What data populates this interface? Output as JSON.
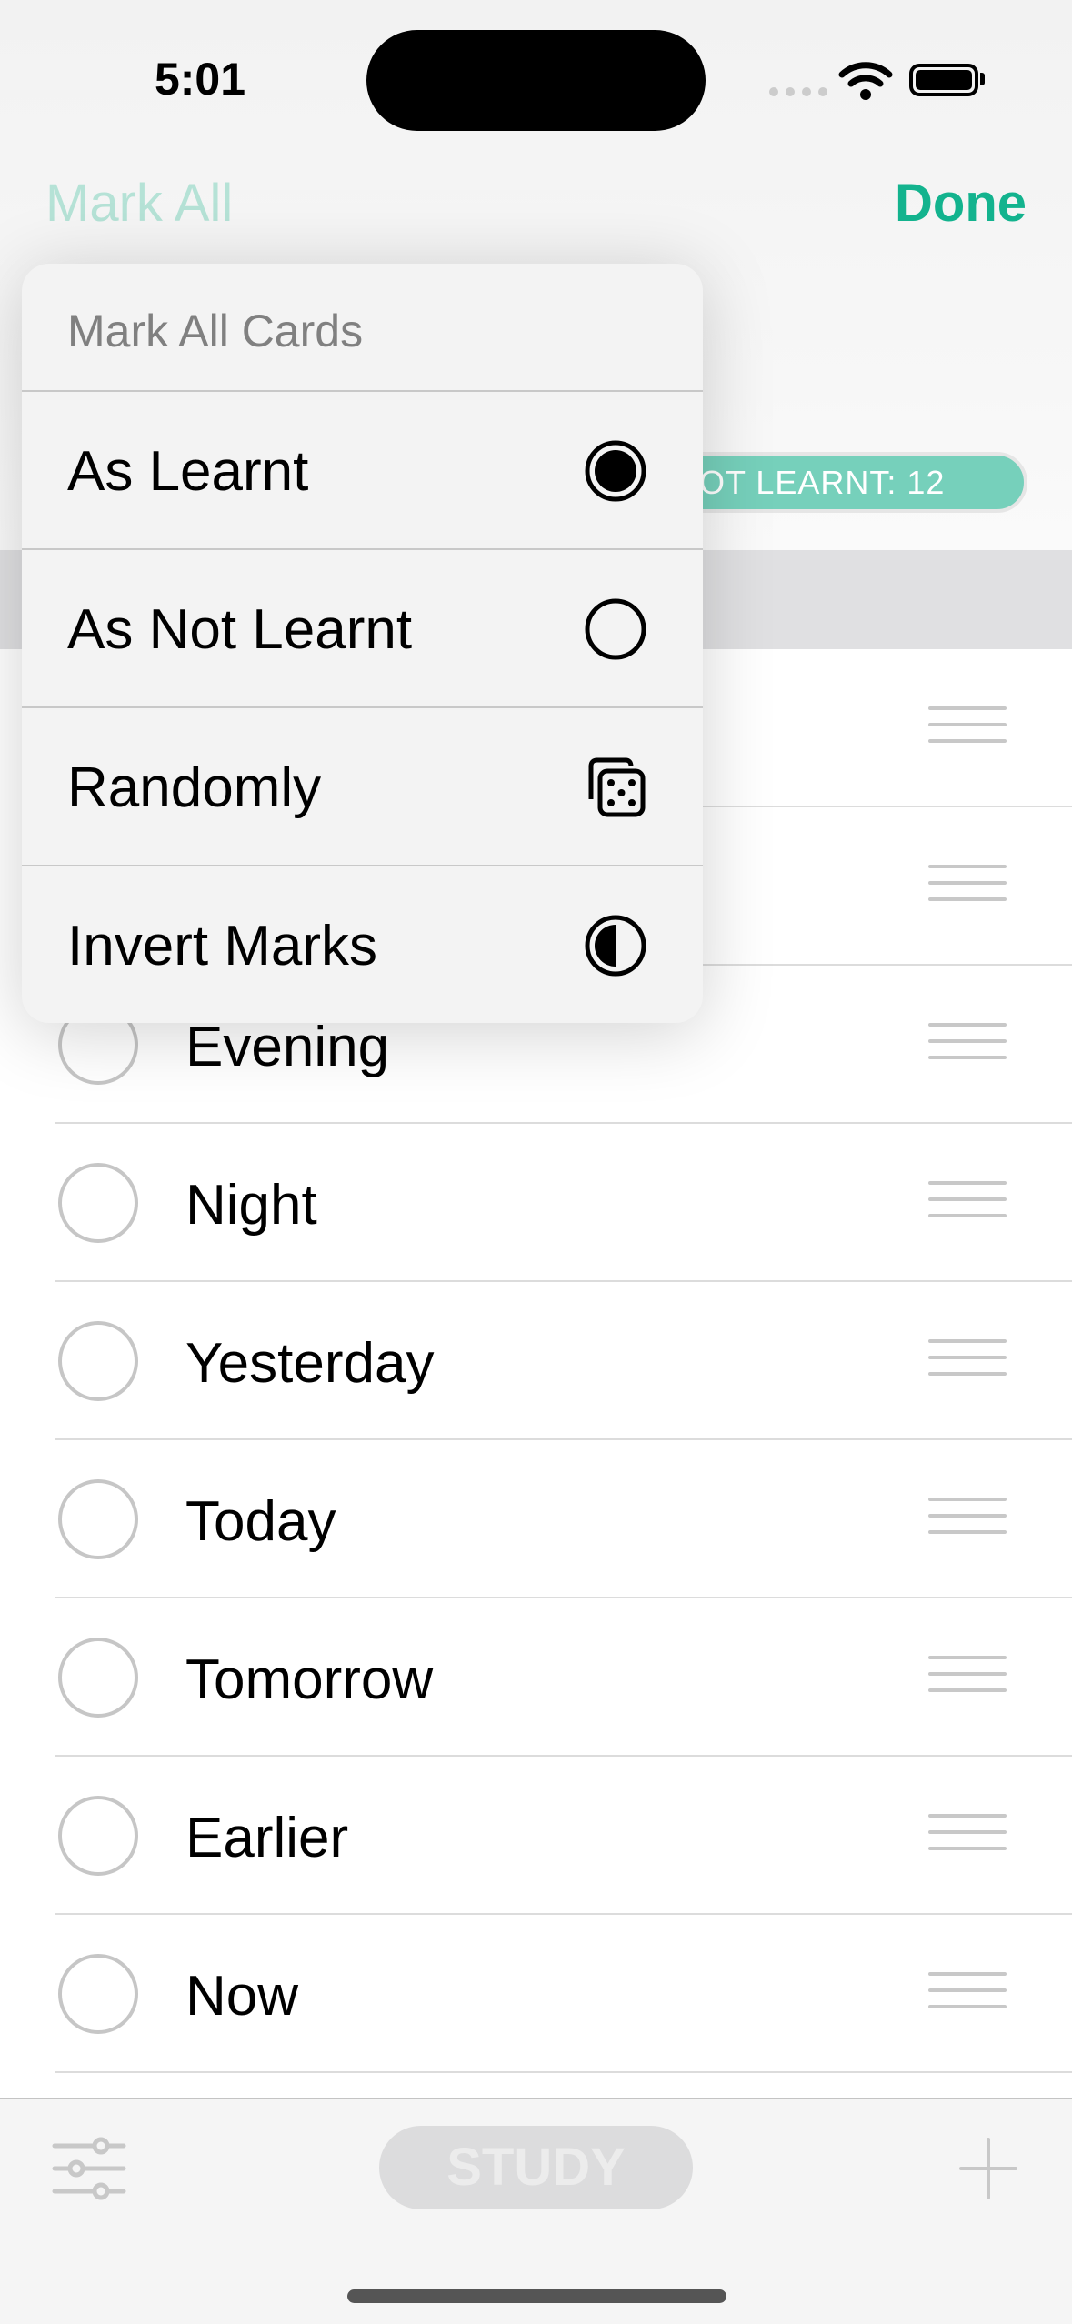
{
  "status_bar": {
    "time": "5:01"
  },
  "nav": {
    "mark_all": "Mark All",
    "done": "Done",
    "accent": "#13b38e"
  },
  "badge": {
    "text": "NOT LEARNT: 12"
  },
  "menu": {
    "title": "Mark All Cards",
    "items": [
      {
        "label": "As Learnt",
        "icon": "filled-circle-icon"
      },
      {
        "label": "As Not Learnt",
        "icon": "empty-circle-icon"
      },
      {
        "label": "Randomly",
        "icon": "dice-icon"
      },
      {
        "label": "Invert Marks",
        "icon": "half-circle-icon"
      }
    ]
  },
  "cards": [
    {
      "label": "Evening"
    },
    {
      "label": "Night"
    },
    {
      "label": "Yesterday"
    },
    {
      "label": "Today"
    },
    {
      "label": "Tomorrow"
    },
    {
      "label": "Earlier"
    },
    {
      "label": "Now"
    }
  ],
  "toolbar": {
    "study": "STUDY"
  }
}
